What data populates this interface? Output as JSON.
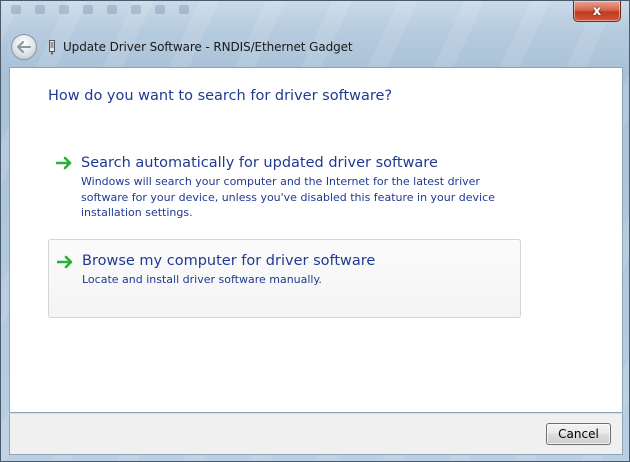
{
  "window": {
    "title": "Update Driver Software - RNDIS/Ethernet Gadget",
    "close_symbol": "x"
  },
  "icons": {
    "back": "back-arrow-icon",
    "device": "device-icon",
    "option_arrow": "green-arrow-icon",
    "close": "close-icon"
  },
  "colors": {
    "link_blue": "#1f3a93",
    "arrow_green": "#2bb036"
  },
  "wizard": {
    "question": "How do you want to search for driver software?",
    "options": [
      {
        "title": "Search automatically for updated driver software",
        "description": "Windows will search your computer and the Internet for the latest driver software for your device, unless you've disabled this feature in your device installation settings."
      },
      {
        "title": "Browse my computer for driver software",
        "description": "Locate and install driver software manually."
      }
    ]
  },
  "footer": {
    "cancel_label": "Cancel"
  }
}
